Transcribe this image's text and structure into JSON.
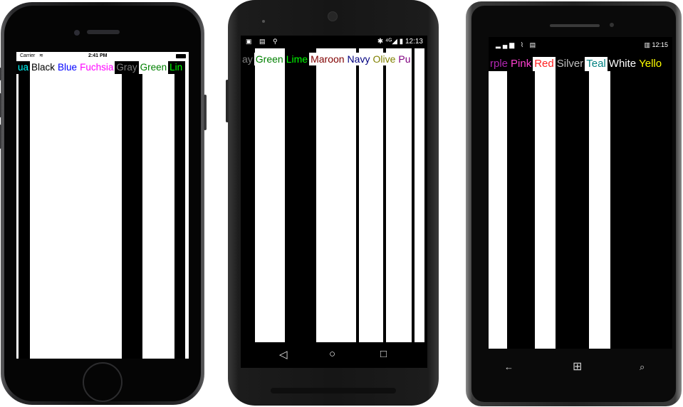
{
  "phones": {
    "ios": {
      "status": {
        "carrier": "Carrier",
        "wifi_icon": "wifi-icon",
        "time": "2:41 PM",
        "battery_icon": "battery-icon"
      },
      "colors": [
        {
          "label": "Aqua",
          "display": "ua",
          "color": "#00ffff",
          "background": "#000000"
        },
        {
          "label": "Black",
          "display": "Black",
          "color": "#000000",
          "background": "#ffffff"
        },
        {
          "label": "Blue",
          "display": "Blue",
          "color": "#0000ff",
          "background": "#ffffff"
        },
        {
          "label": "Fuchsia",
          "display": "Fuchsia",
          "color": "#ff00ff",
          "background": "#ffffff"
        },
        {
          "label": "Gray",
          "display": "Gray",
          "color": "#808080",
          "background": "#000000"
        },
        {
          "label": "Green",
          "display": "Green",
          "color": "#008000",
          "background": "#ffffff"
        },
        {
          "label": "Lime",
          "display": "Lin",
          "color": "#00ff00",
          "background": "#000000"
        }
      ]
    },
    "android": {
      "status": {
        "left_icons": "▣ ▤ ⚲",
        "right": "✱ ⁴ᴳ◢ ▮ 12:13"
      },
      "colors": [
        {
          "label": "Gray",
          "display": "ay",
          "color": "#808080",
          "background": "#000000"
        },
        {
          "label": "Green",
          "display": "Green",
          "color": "#008000",
          "background": "#ffffff"
        },
        {
          "label": "Lime",
          "display": "Lime",
          "color": "#00ff00",
          "background": "#000000"
        },
        {
          "label": "Maroon",
          "display": "Maroon",
          "color": "#800000",
          "background": "#ffffff"
        },
        {
          "label": "Navy",
          "display": "Navy",
          "color": "#000080",
          "background": "#ffffff"
        },
        {
          "label": "Olive",
          "display": "Olive",
          "color": "#808000",
          "background": "#ffffff"
        },
        {
          "label": "Purple",
          "display": "Pu",
          "color": "#800080",
          "background": "#ffffff"
        }
      ],
      "nav": {
        "back": "◁",
        "home": "○",
        "recents": "□"
      }
    },
    "windows": {
      "status": {
        "left": "▂▄▆ ⌇ ▤",
        "right": "▥ 12:15"
      },
      "colors": [
        {
          "label": "Purple",
          "display": "rple",
          "color": "#b026b0",
          "background": "#000000"
        },
        {
          "label": "Pink",
          "display": "Pink",
          "color": "#ff40d0",
          "background": "#000000"
        },
        {
          "label": "Red",
          "display": "Red",
          "color": "#ff2020",
          "background": "#ffffff"
        },
        {
          "label": "Silver",
          "display": "Silver",
          "color": "#c0c0c0",
          "background": "#000000"
        },
        {
          "label": "Teal",
          "display": "Teal",
          "color": "#008080",
          "background": "#ffffff"
        },
        {
          "label": "White",
          "display": "White",
          "color": "#ffffff",
          "background": "#000000"
        },
        {
          "label": "Yellow",
          "display": "Yello",
          "color": "#ffff00",
          "background": "#000000"
        }
      ],
      "nav": {
        "back": "←",
        "start": "⊞",
        "search": "⌕"
      }
    }
  }
}
